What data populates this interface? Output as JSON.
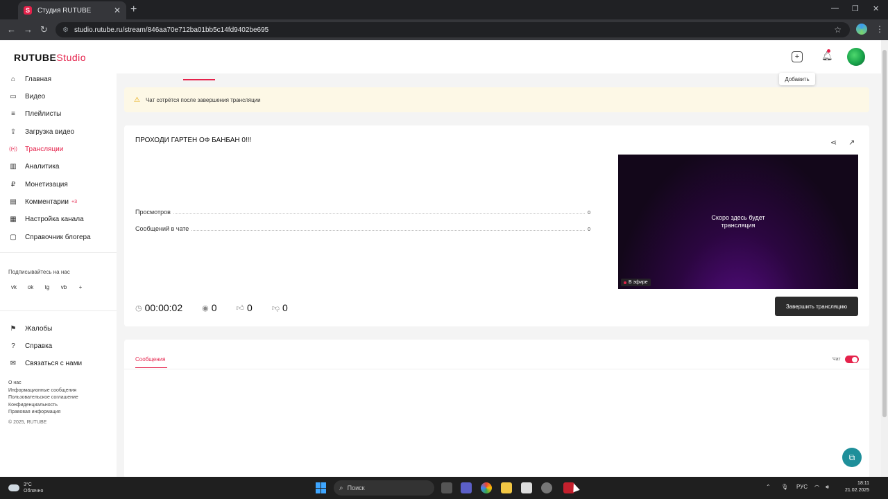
{
  "browser": {
    "tab_title": "Студия RUTUBE",
    "favicon": "S",
    "close_glyph": "✕",
    "newtab_glyph": "+",
    "url": "studio.rutube.ru/stream/846aa70e712ba01bb5c14fd9402be695",
    "back_glyph": "←",
    "forward_glyph": "→",
    "reload_glyph": "↻",
    "win_min": "—",
    "win_max": "❐",
    "win_close": "✕"
  },
  "header": {
    "logo_main": "RUTUBE",
    "logo_studio": "Studio",
    "add_tooltip": "Добавить",
    "accent": "#e5224b"
  },
  "sidebar": {
    "items": [
      {
        "label": "Главная",
        "icon": "⌂"
      },
      {
        "label": "Видео",
        "icon": "▭"
      },
      {
        "label": "Плейлисты",
        "icon": "≡"
      },
      {
        "label": "Загрузка видео",
        "icon": "⇪"
      },
      {
        "label": "Трансляции",
        "icon": "((•))"
      },
      {
        "label": "Аналитика",
        "icon": "▥"
      },
      {
        "label": "Монетизация",
        "icon": "₽"
      },
      {
        "label": "Комментарии",
        "icon": "▤",
        "badge": "+3"
      },
      {
        "label": "Настройка канала",
        "icon": "▦"
      },
      {
        "label": "Справочник блогера",
        "icon": "▢"
      }
    ],
    "subscribe_label": "Подписывайтесь на нас",
    "socials": [
      "vk",
      "ok",
      "tg",
      "vb",
      "+"
    ],
    "bottom_items": [
      {
        "label": "Жалобы",
        "icon": "⚑"
      },
      {
        "label": "Справка",
        "icon": "?"
      },
      {
        "label": "Связаться с нами",
        "icon": "✉"
      }
    ],
    "footer_links": [
      "О нас",
      "Информационные сообщения",
      "Пользовательское соглашение",
      "Конфиденциальность",
      "Правовая информация"
    ],
    "copyright": "© 2025, RUTUBE"
  },
  "main": {
    "warning_text": "Чат сотрётся после завершения трансляции",
    "stream_title": "ПРОХОДИ ГАРТЕН ОФ БАНБАН 0!!!",
    "stats": [
      {
        "label": "Просмотров",
        "value": "0"
      },
      {
        "label": "Сообщений в чате",
        "value": "0"
      }
    ],
    "preview_message_line1": "Скоро здесь будет",
    "preview_message_line2": "трансляция",
    "live_badge": "В эфире",
    "timer": "00:00:02",
    "viewers": "0",
    "likes": "0",
    "dislikes": "0",
    "end_button": "Завершить трансляцию"
  },
  "chat": {
    "tab_messages": "Сообщения",
    "toggle_label": "Чат",
    "toggle_on": true
  },
  "taskbar": {
    "weather_temp": "3°C",
    "weather_desc": "Облачно",
    "search_placeholder": "Поиск",
    "language": "РУС",
    "time": "18:11",
    "date": "21.02.2025"
  }
}
